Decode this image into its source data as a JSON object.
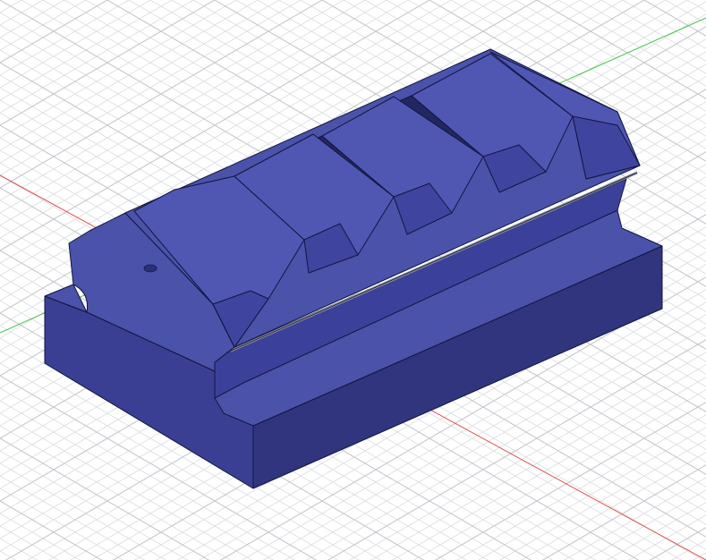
{
  "viewport": {
    "background": "#ffffff",
    "grid_color": "#d9dce0",
    "grid_major_color": "#c9ccd1",
    "axis_x_color": "#e05050",
    "axis_y_color": "#47c447"
  },
  "model": {
    "shape": "picatinny-rail-mount",
    "slot_count": 5,
    "colors": {
      "top": "#4a52a9",
      "side_left": "#3a3f93",
      "side_front": "#30357d",
      "groove_dark": "#22275f",
      "edge": "#121640",
      "seam": "#8c8f96"
    }
  }
}
